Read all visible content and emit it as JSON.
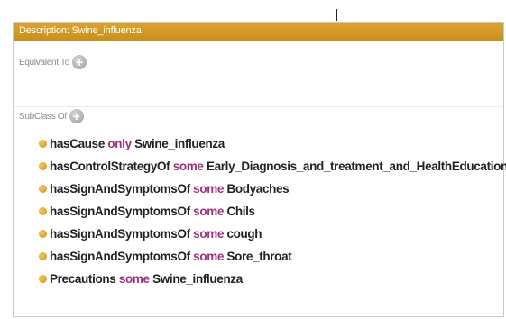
{
  "header": {
    "title": "Description: Swine_influenza"
  },
  "sections": {
    "equivalent_to": {
      "label": "Equivalent To",
      "add_label": "+"
    },
    "subclass_of": {
      "label": "SubClass Of",
      "add_label": "+"
    }
  },
  "axioms": [
    {
      "property": "hasCause",
      "keyword": "only",
      "filler": "Swine_influenza"
    },
    {
      "property": "hasControlStrategyOf",
      "keyword": "some",
      "filler": "Early_Diagnosis_and_treatment_and_HealthEducation"
    },
    {
      "property": "hasSignAndSymptomsOf",
      "keyword": "some",
      "filler": "Bodyaches"
    },
    {
      "property": "hasSignAndSymptomsOf",
      "keyword": "some",
      "filler": "Chils"
    },
    {
      "property": "hasSignAndSymptomsOf",
      "keyword": "some",
      "filler": "cough"
    },
    {
      "property": "hasSignAndSymptomsOf",
      "keyword": "some",
      "filler": "Sore_throat"
    },
    {
      "property": "Precautions",
      "keyword": "some",
      "filler": "Swine_influenza"
    }
  ],
  "colors": {
    "title_bar": "#d49a27",
    "keyword": "#a0307f",
    "bullet": "#e0a93a"
  },
  "icons": {
    "add": "add-circle-icon",
    "bullet": "class-bullet-icon"
  }
}
